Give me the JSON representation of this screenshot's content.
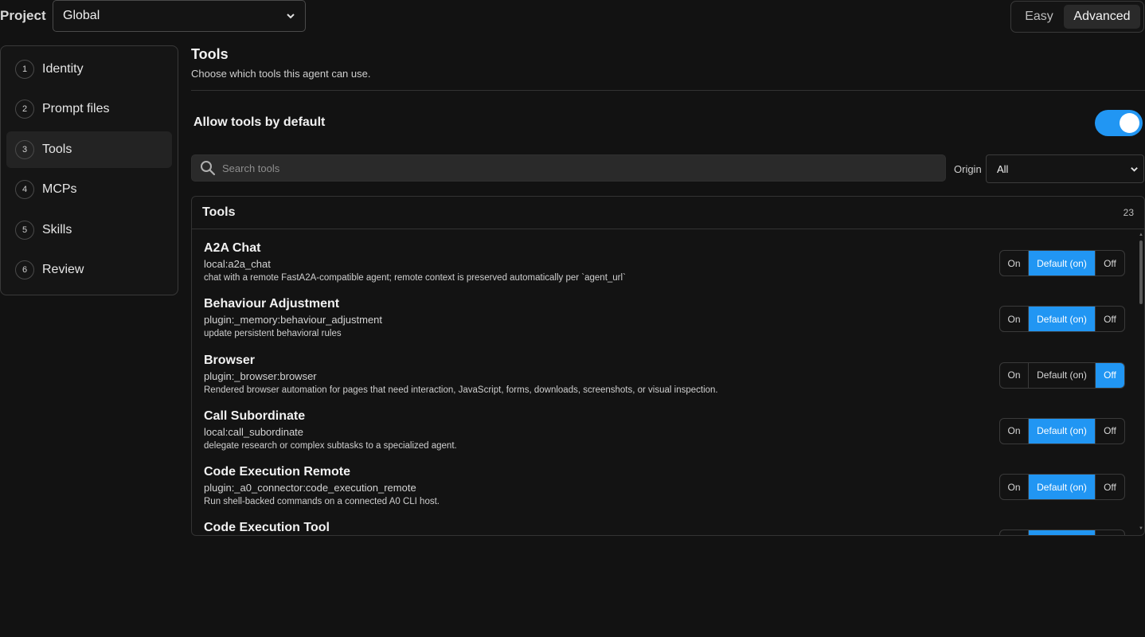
{
  "header": {
    "project_label": "Project",
    "project_value": "Global",
    "mode_easy": "Easy",
    "mode_advanced": "Advanced",
    "mode_selected": "Advanced"
  },
  "sidebar": {
    "steps": [
      {
        "num": "1",
        "label": "Identity",
        "active": false
      },
      {
        "num": "2",
        "label": "Prompt files",
        "active": false
      },
      {
        "num": "3",
        "label": "Tools",
        "active": true
      },
      {
        "num": "4",
        "label": "MCPs",
        "active": false
      },
      {
        "num": "5",
        "label": "Skills",
        "active": false
      },
      {
        "num": "6",
        "label": "Review",
        "active": false
      }
    ]
  },
  "main": {
    "title": "Tools",
    "subtitle": "Choose which tools this agent can use.",
    "allow_label": "Allow tools by default",
    "allow_enabled": true,
    "search_placeholder": "Search tools",
    "origin_label": "Origin",
    "origin_value": "All"
  },
  "panel": {
    "title": "Tools",
    "count": "23",
    "segment_labels": {
      "on": "On",
      "default": "Default (on)",
      "off": "Off"
    },
    "tools": [
      {
        "name": "A2A Chat",
        "id": "local:a2a_chat",
        "desc": "chat with a remote FastA2A-compatible agent; remote context is preserved automatically per `agent_url`",
        "state": "default"
      },
      {
        "name": "Behaviour Adjustment",
        "id": "plugin:_memory:behaviour_adjustment",
        "desc": "update persistent behavioral rules",
        "state": "default"
      },
      {
        "name": "Browser",
        "id": "plugin:_browser:browser",
        "desc": "Rendered browser automation for pages that need interaction, JavaScript, forms, downloads, screenshots, or visual inspection.",
        "state": "off"
      },
      {
        "name": "Call Subordinate",
        "id": "local:call_subordinate",
        "desc": "delegate research or complex subtasks to a specialized agent.",
        "state": "default"
      },
      {
        "name": "Code Execution Remote",
        "id": "plugin:_a0_connector:code_execution_remote",
        "desc": "Run shell-backed commands on a connected A0 CLI host.",
        "state": "default"
      },
      {
        "name": "Code Execution Tool",
        "id": "",
        "desc": "",
        "state": "default"
      }
    ]
  },
  "colors": {
    "accent": "#2196f3",
    "background": "#121212"
  }
}
